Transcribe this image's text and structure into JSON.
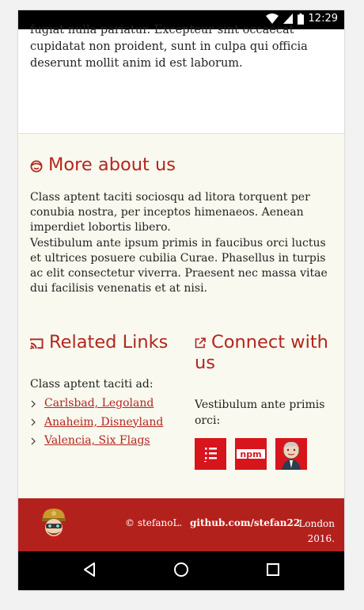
{
  "status_bar": {
    "time": "12:29"
  },
  "top": {
    "text": "fugiat nulla pariatur. Excepteur sint occaecat cupidatat non proident, sunt in culpa qui officia deserunt mollit anim id est laborum."
  },
  "more_about": {
    "title": "More about us",
    "paragraph1": "Class aptent taciti sociosqu ad litora torquent per conubia nostra, per inceptos himenaeos. Aenean imperdiet lobortis libero.",
    "paragraph2": "Vestibulum ante ipsum primis in faucibus orci luctus et ultrices posuere cubilia Curae. Phasellus in turpis ac elit consectetur viverra. Praesent nec massa vitae dui facilisis venenatis et at nisi."
  },
  "related": {
    "title": "Related Links",
    "intro": "Class aptent taciti ad:",
    "links": [
      "Carlsbad, Legoland",
      "Anaheim, Disneyland",
      "Valencia, Six Flags"
    ]
  },
  "connect": {
    "title": "Connect with us",
    "text": "Vestibulum ante primis orci:",
    "icons": [
      "stacklist-icon",
      "npm-icon",
      "jenkins-icon"
    ],
    "npm_label": "npm"
  },
  "footer": {
    "copyright": "© stefanoL.",
    "link": "github.com/stefan22",
    "location": "London 2016."
  },
  "colors": {
    "accent": "#b3261e",
    "footer_bg": "#b3211c",
    "section_bg": "#f9f9ef"
  }
}
